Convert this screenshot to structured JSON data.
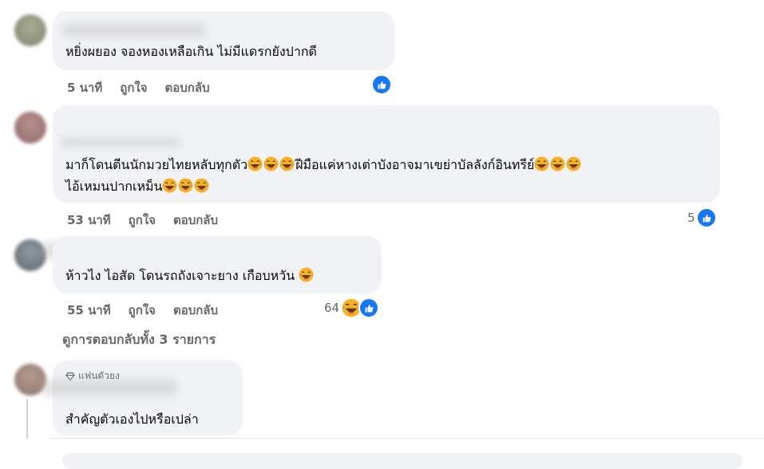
{
  "comments": [
    {
      "text_lines": [
        "หยิ่งผยอง จองหองเหลือเกิน ไม่มีแดรกยังปากดี"
      ],
      "time": "5 นาที",
      "like": "ถูกใจ",
      "reply": "ตอบกลับ",
      "reaction_count": ""
    },
    {
      "text_lines": [
        "มาก็โดนตีนนักมวยไทยหลับทุกตัว",
        "ฝีมือแค่หางเต่าบังอาจมาเขย่าบัลลังก์อินทรีย์",
        "ไอ้เหมนปากเหม็น"
      ],
      "time": "53 นาที",
      "like": "ถูกใจ",
      "reply": "ตอบกลับ",
      "reaction_count": "5"
    },
    {
      "text_lines": [
        "ห้าวไง ไอสัด โดนรถถังเจาะยาง เกือบหวัน"
      ],
      "time": "55 นาที",
      "like": "ถูกใจ",
      "reply": "ตอบกลับ",
      "reaction_count": "64"
    },
    {
      "badge": "แฟนตัวยง",
      "text_lines": [
        "สำคัญตัวเองไปหรือเปล่า"
      ]
    }
  ],
  "view_replies": "ดูการตอบกลับทั้ง 3 รายการ",
  "colors": {
    "like_blue": "#1877f2",
    "bubble_bg": "#f0f2f5",
    "meta_gray": "#65676b",
    "haha_yellow": "#f7b125"
  },
  "icons": {
    "like": "thumbs-up-icon",
    "haha": "laughing-emoji-icon",
    "badge": "diamond-icon"
  }
}
